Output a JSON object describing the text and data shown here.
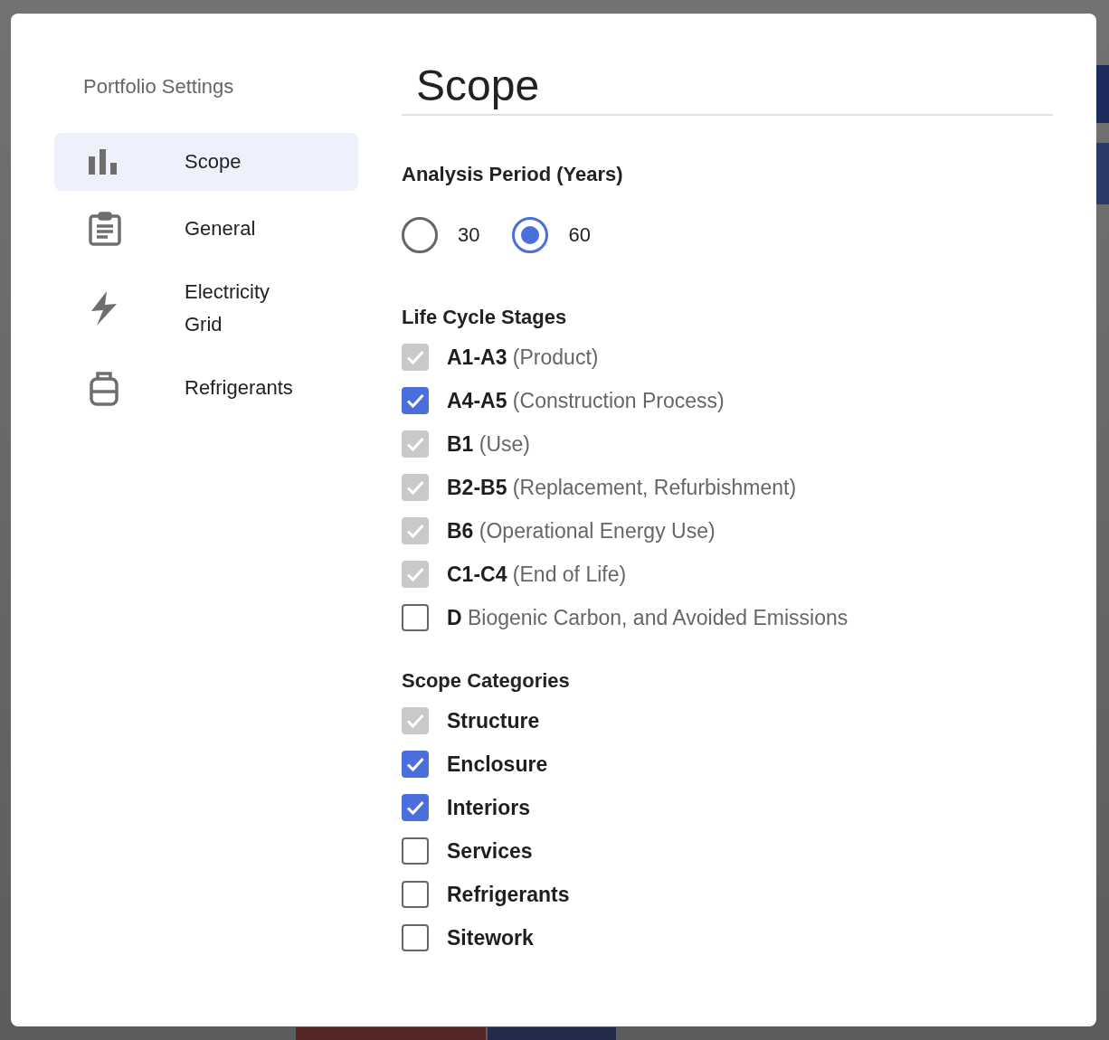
{
  "sidebar": {
    "title": "Portfolio Settings",
    "items": [
      {
        "label": "Scope",
        "selected": true
      },
      {
        "label": "General",
        "selected": false
      },
      {
        "label": "Electricity Grid",
        "selected": false
      },
      {
        "label": "Refrigerants",
        "selected": false
      }
    ]
  },
  "page_title": "Scope",
  "analysis_period": {
    "label": "Analysis Period (Years)",
    "options": [
      {
        "label": "30",
        "selected": false
      },
      {
        "label": "60",
        "selected": true
      }
    ]
  },
  "life_cycle_stages": {
    "label": "Life Cycle Stages",
    "items": [
      {
        "code": "A1-A3",
        "description": "(Product)",
        "checked": true,
        "disabled": true
      },
      {
        "code": "A4-A5",
        "description": "(Construction Process)",
        "checked": true,
        "disabled": false
      },
      {
        "code": "B1",
        "description": "(Use)",
        "checked": true,
        "disabled": true
      },
      {
        "code": "B2-B5",
        "description": "(Replacement, Refurbishment)",
        "checked": true,
        "disabled": true
      },
      {
        "code": "B6",
        "description": "(Operational Energy Use)",
        "checked": true,
        "disabled": true
      },
      {
        "code": "C1-C4",
        "description": "(End of Life)",
        "checked": true,
        "disabled": true
      },
      {
        "code": "D",
        "description": "Biogenic Carbon, and Avoided Emissions",
        "checked": false
      }
    ]
  },
  "scope_categories": {
    "label": "Scope Categories",
    "items": [
      {
        "label": "Structure",
        "checked": true,
        "disabled": true
      },
      {
        "label": "Enclosure",
        "checked": true,
        "disabled": false
      },
      {
        "label": "Interiors",
        "checked": true,
        "disabled": false
      },
      {
        "label": "Services",
        "checked": false
      },
      {
        "label": "Refrigerants",
        "checked": false
      },
      {
        "label": "Sitework",
        "checked": false
      }
    ]
  }
}
